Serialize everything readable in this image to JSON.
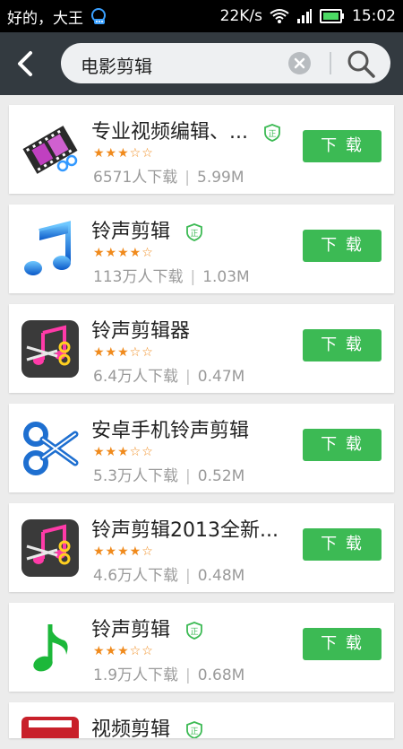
{
  "status": {
    "left_text": "好的，大王",
    "speed": "22K/s",
    "time": "15:02"
  },
  "search": {
    "query": "电影剪辑"
  },
  "apps": [
    {
      "name": "专业视频编辑、...",
      "verified": true,
      "rating": 2.5,
      "stars": "★★★☆☆",
      "downloads": "6571人下载",
      "size": "5.99M",
      "button": "下 载",
      "icon": "film-scissors-icon"
    },
    {
      "name": "铃声剪辑",
      "verified": true,
      "rating": 4,
      "stars": "★★★★☆",
      "downloads": "113万人下载",
      "size": "1.03M",
      "button": "下 载",
      "icon": "music-note-blue-icon"
    },
    {
      "name": "铃声剪辑器",
      "verified": false,
      "rating": 3,
      "stars": "★★★☆☆",
      "downloads": "6.4万人下载",
      "size": "0.47M",
      "button": "下 载",
      "icon": "note-scissors-icon"
    },
    {
      "name": "安卓手机铃声剪辑",
      "verified": false,
      "rating": 3,
      "stars": "★★★☆☆",
      "downloads": "5.3万人下载",
      "size": "0.52M",
      "button": "下 载",
      "icon": "blue-scissors-icon"
    },
    {
      "name": "铃声剪辑2013全新...",
      "verified": false,
      "rating": 4,
      "stars": "★★★★☆",
      "downloads": "4.6万人下载",
      "size": "0.48M",
      "button": "下 载",
      "icon": "note-scissors-icon"
    },
    {
      "name": "铃声剪辑",
      "verified": true,
      "rating": 3.5,
      "stars": "★★★☆☆",
      "downloads": "1.9万人下载",
      "size": "0.68M",
      "button": "下 载",
      "icon": "music-note-green-icon"
    },
    {
      "name": "视频剪辑",
      "verified": true,
      "icon": "video-icon"
    }
  ],
  "colors": {
    "download_button": "#3cba54",
    "header": "#333a40",
    "star": "#f08a1c"
  }
}
